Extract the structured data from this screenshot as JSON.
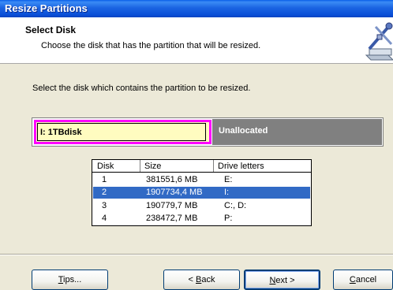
{
  "window": {
    "title": "Resize Partitions"
  },
  "header": {
    "title": "Select Disk",
    "subtitle": "Choose the disk that has the partition that will be resized."
  },
  "instruction": "Select the disk which contains the partition to be resized.",
  "partition_map": {
    "selected_label": "I:  1TBdisk",
    "unallocated_label": "Unallocated",
    "colors": {
      "selected_fill": "#fffcc0",
      "selected_border": "#ff00ff",
      "unallocated_fill": "#808080"
    }
  },
  "disk_table": {
    "columns": [
      "Disk",
      "Size",
      "Drive letters"
    ],
    "rows": [
      {
        "disk": "1",
        "size": "381551,6 MB",
        "letters": "E:",
        "selected": false
      },
      {
        "disk": "2",
        "size": "1907734,4 MB",
        "letters": "I:",
        "selected": true
      },
      {
        "disk": "3",
        "size": "190779,7 MB",
        "letters": "C:, D:",
        "selected": false
      },
      {
        "disk": "4",
        "size": "238472,7 MB",
        "letters": "P:",
        "selected": false
      }
    ],
    "selection_color": "#316ac5"
  },
  "buttons": {
    "tips": {
      "pre": "",
      "key": "T",
      "post": "ips..."
    },
    "back": {
      "pre": "< ",
      "key": "B",
      "post": "ack"
    },
    "next": {
      "pre": "",
      "key": "N",
      "post": "ext >"
    },
    "cancel": {
      "pre": "",
      "key": "C",
      "post": "ancel"
    }
  },
  "icons": {
    "header": "resize-tool-icon"
  }
}
